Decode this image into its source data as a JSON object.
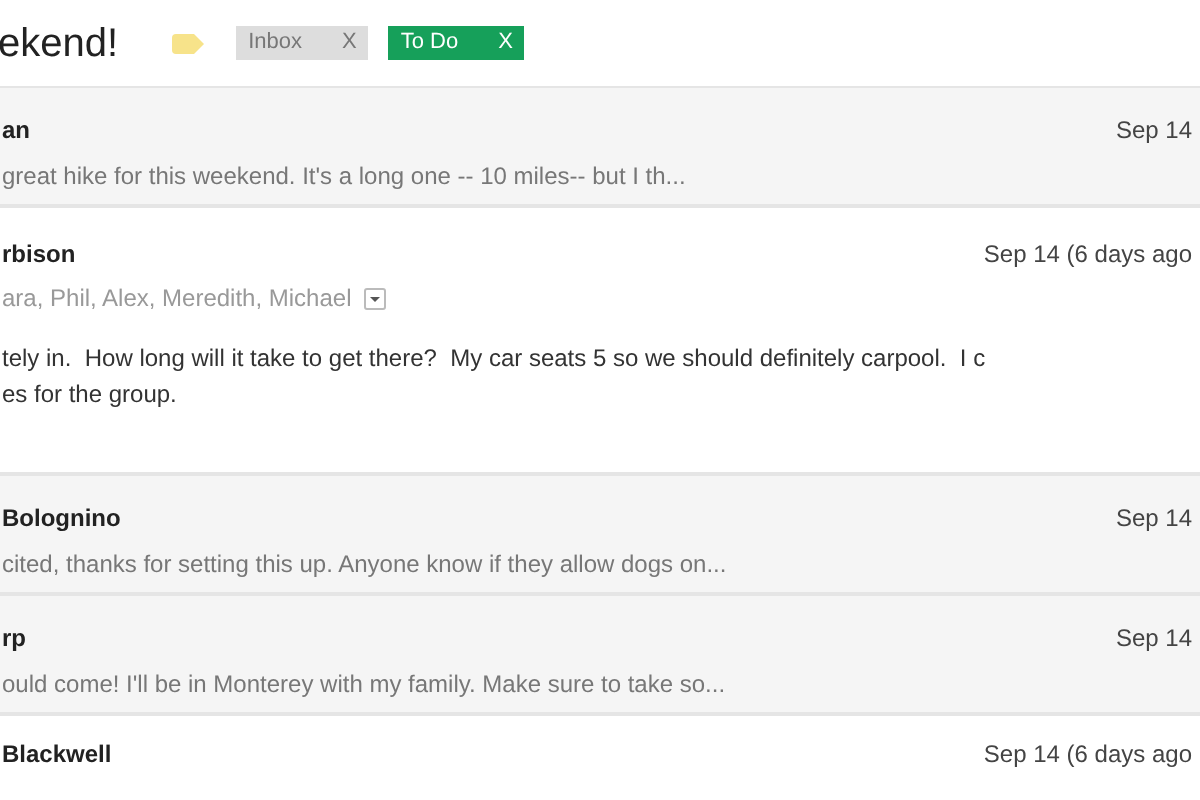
{
  "subject": {
    "title": "ekend!",
    "labels": [
      {
        "text": "Inbox",
        "remove": "X",
        "color": "#dddddd"
      },
      {
        "text": "To Do",
        "remove": "X",
        "color": "#16a05a"
      }
    ]
  },
  "messages": [
    {
      "expanded": false,
      "sender": "an",
      "date": "Sep 14",
      "snippet": "great hike for this weekend. It's a long one -- 10 miles-- but I th..."
    },
    {
      "expanded": true,
      "sender": "rbison",
      "date": "Sep 14 (6 days ago",
      "recipients": "ara, Phil, Alex, Meredith, Michael",
      "body": [
        "tely in.  How long will it take to get there?  My car seats 5 so we should definitely carpool.  I c",
        "es for the group."
      ]
    },
    {
      "expanded": false,
      "sender": "Bolognino",
      "date": "Sep 14",
      "snippet": "cited, thanks for setting this up. Anyone know if they allow dogs on..."
    },
    {
      "expanded": false,
      "sender": "rp",
      "date": "Sep 14",
      "snippet": "ould come! I'll be in Monterey with my family. Make sure to take so..."
    },
    {
      "expanded": true,
      "sender": "Blackwell",
      "date": "Sep 14 (6 days ago"
    }
  ]
}
